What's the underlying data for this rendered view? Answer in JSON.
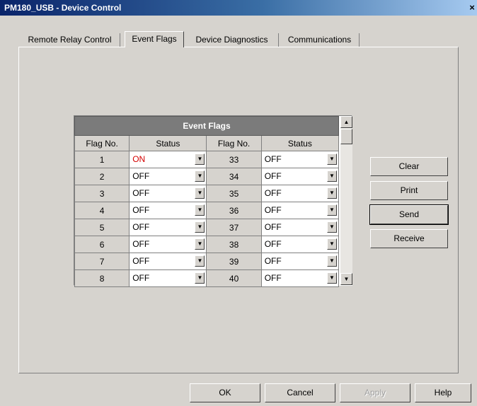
{
  "window": {
    "title": "PM180_USB - Device Control",
    "close_glyph": "×"
  },
  "tabs": [
    {
      "label": "Remote Relay Control",
      "active": false
    },
    {
      "label": "Event Flags",
      "active": true
    },
    {
      "label": "Device Diagnostics",
      "active": false
    },
    {
      "label": "Communications",
      "active": false
    }
  ],
  "grid": {
    "title": "Event Flags",
    "col_flag": "Flag No.",
    "col_status": "Status",
    "rows": [
      {
        "left_no": "1",
        "left_status": "ON",
        "right_no": "33",
        "right_status": "OFF"
      },
      {
        "left_no": "2",
        "left_status": "OFF",
        "right_no": "34",
        "right_status": "OFF"
      },
      {
        "left_no": "3",
        "left_status": "OFF",
        "right_no": "35",
        "right_status": "OFF"
      },
      {
        "left_no": "4",
        "left_status": "OFF",
        "right_no": "36",
        "right_status": "OFF"
      },
      {
        "left_no": "5",
        "left_status": "OFF",
        "right_no": "37",
        "right_status": "OFF"
      },
      {
        "left_no": "6",
        "left_status": "OFF",
        "right_no": "38",
        "right_status": "OFF"
      },
      {
        "left_no": "7",
        "left_status": "OFF",
        "right_no": "39",
        "right_status": "OFF"
      },
      {
        "left_no": "8",
        "left_status": "OFF",
        "right_no": "40",
        "right_status": "OFF"
      }
    ],
    "status_on_color": "#d40000",
    "header_color": "#7b7b7b"
  },
  "icons": {
    "dropdown": "▼",
    "scroll_up": "▲",
    "scroll_down": "▼"
  },
  "side_buttons": {
    "clear": "Clear",
    "print": "Print",
    "send": "Send",
    "receive": "Receive"
  },
  "footer_buttons": {
    "ok": "OK",
    "cancel": "Cancel",
    "apply": "Apply",
    "help": "Help"
  }
}
